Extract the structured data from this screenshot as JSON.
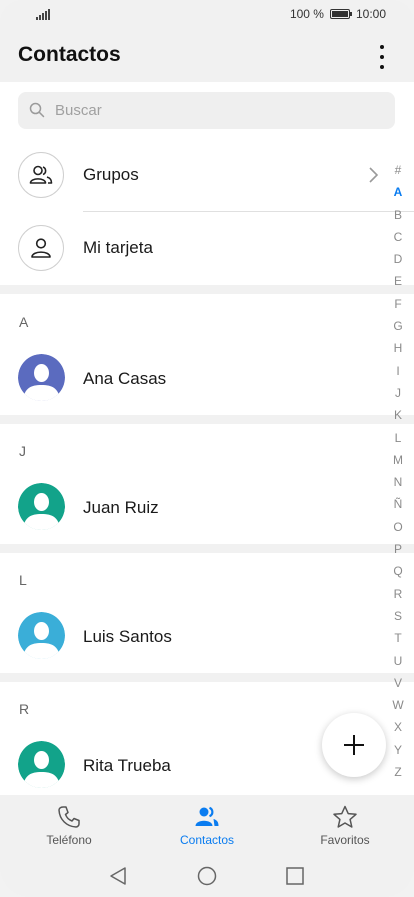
{
  "status_bar": {
    "battery_text": "100 %",
    "time": "10:00",
    "battery_level": 1.0
  },
  "header": {
    "title": "Contactos"
  },
  "search": {
    "placeholder": "Buscar"
  },
  "top_rows": [
    {
      "label": "Grupos"
    },
    {
      "label": "Mi tarjeta"
    }
  ],
  "sections": [
    {
      "letter": "A",
      "contact": {
        "name": "Ana Casas",
        "avatar_color": "#5b6bbf"
      }
    },
    {
      "letter": "J",
      "contact": {
        "name": "Juan Ruiz",
        "avatar_color": "#12a38a"
      }
    },
    {
      "letter": "L",
      "contact": {
        "name": "Luis Santos",
        "avatar_color": "#3aaed8"
      }
    },
    {
      "letter": "R",
      "contact": {
        "name": "Rita Trueba",
        "avatar_color": "#12a38a"
      }
    }
  ],
  "alpha_index": [
    "#",
    "A",
    "B",
    "C",
    "D",
    "E",
    "F",
    "G",
    "H",
    "I",
    "J",
    "K",
    "L",
    "M",
    "N",
    "Ñ",
    "O",
    "P",
    "Q",
    "R",
    "S",
    "T",
    "U",
    "V",
    "W",
    "X",
    "Y",
    "Z"
  ],
  "alpha_active": "A",
  "bottom_nav": [
    {
      "label": "Teléfono",
      "icon": "phone-icon",
      "active": false
    },
    {
      "label": "Contactos",
      "icon": "contacts-icon",
      "active": true
    },
    {
      "label": "Favoritos",
      "icon": "star-icon",
      "active": false
    }
  ],
  "colors": {
    "accent": "#0a7cf0"
  }
}
